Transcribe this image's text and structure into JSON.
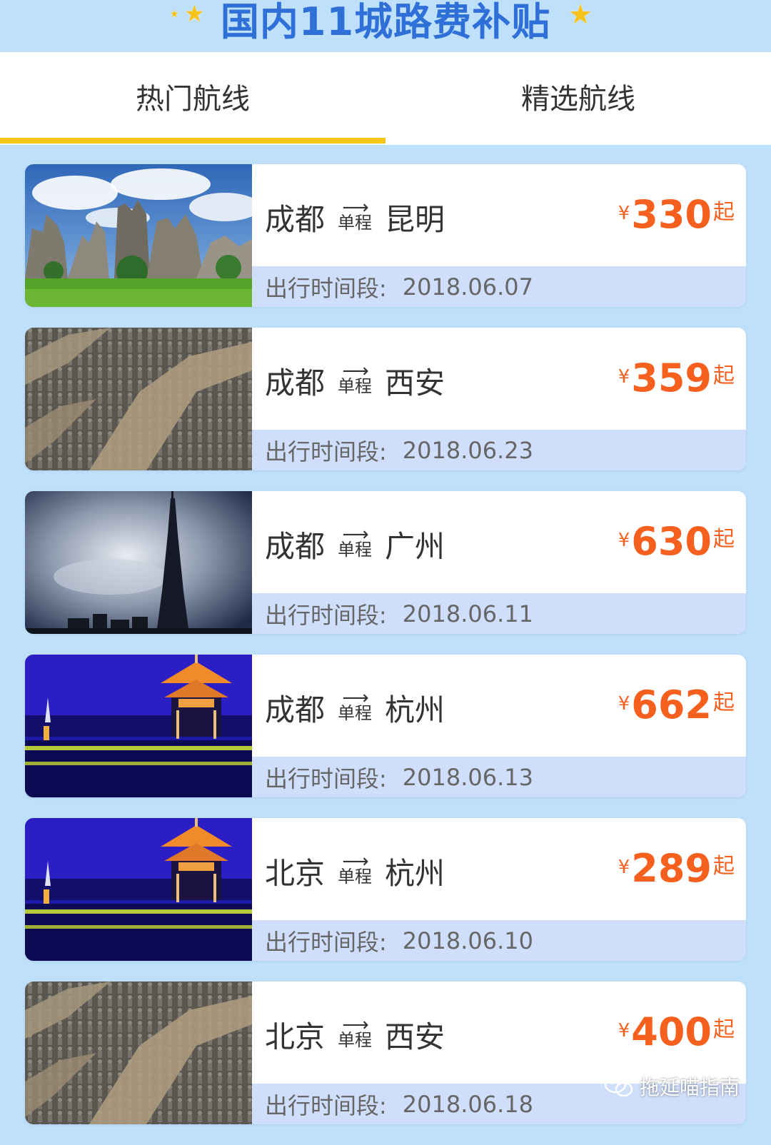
{
  "banner": {
    "title": "国内11城路费补贴"
  },
  "tabs": [
    {
      "label": "热门航线",
      "active": true
    },
    {
      "label": "精选航线",
      "active": false
    }
  ],
  "oneway_label": "单程",
  "period_label": "出行时间段:",
  "currency": "¥",
  "price_suffix": "起",
  "routes": [
    {
      "from": "成都",
      "to": "昆明",
      "price": "330",
      "date": "2018.06.07",
      "image": "stone-forest"
    },
    {
      "from": "成都",
      "to": "西安",
      "price": "359",
      "date": "2018.06.23",
      "image": "terracotta-army"
    },
    {
      "from": "成都",
      "to": "广州",
      "price": "630",
      "date": "2018.06.11",
      "image": "canton-tower"
    },
    {
      "from": "成都",
      "to": "杭州",
      "price": "662",
      "date": "2018.06.13",
      "image": "west-lake-pavilion"
    },
    {
      "from": "北京",
      "to": "杭州",
      "price": "289",
      "date": "2018.06.10",
      "image": "west-lake-pavilion"
    },
    {
      "from": "北京",
      "to": "西安",
      "price": "400",
      "date": "2018.06.18",
      "image": "terracotta-army"
    }
  ],
  "watermark": {
    "text": "拖延喵指南"
  },
  "colors": {
    "background": "#bfe0fb",
    "title": "#2e6fd8",
    "tab_indicator": "#f7c619",
    "price": "#f5601e",
    "period_bg": "#cfdefb"
  }
}
